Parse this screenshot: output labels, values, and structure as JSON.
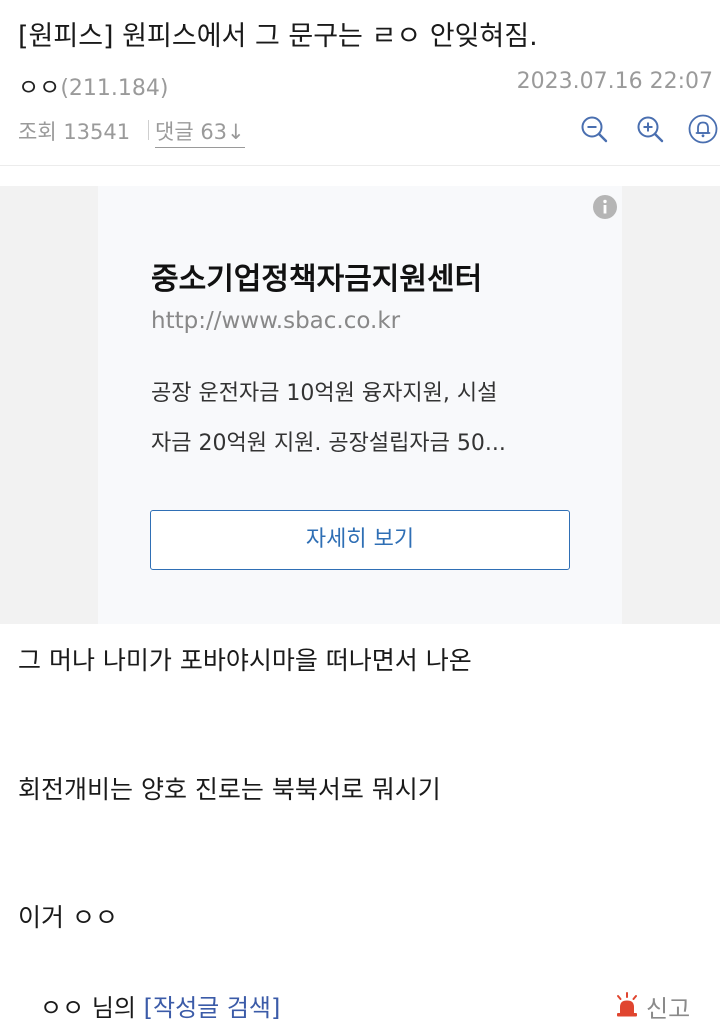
{
  "post": {
    "title": "[원피스] 원피스에서 그 문구는 ㄹㅇ 안잊혀짐.",
    "author": "ㅇㅇ",
    "ip": "(211.184)",
    "date": "2023.07.16 22:07",
    "views_label": "조회 13541",
    "comments_label": "댓글 63↓"
  },
  "toolbar": {
    "icons": [
      "zoom-out-icon",
      "zoom-in-icon",
      "bell-icon"
    ]
  },
  "ad": {
    "title": "중소기업정책자금지원센터",
    "url": "http://www.sbac.co.kr",
    "desc_lines": [
      "공장 운전자금 10억원 융자지원, 시설",
      "자금 20억원 지원. 공장설립자금 50..."
    ],
    "button_label": "자세히 보기",
    "info_icon": "info-icon"
  },
  "body": {
    "lines": [
      "그 머나 나미가 포바야시마을 떠나면서 나온",
      "회전개비는 양호 진로는 북북서로 뭐시기",
      "이거 ㅇㅇ"
    ]
  },
  "footer": {
    "author_name": "ㅇㅇ",
    "author_suffix": "님의",
    "search_link": "[작성글 검색]",
    "report_label": "신고",
    "report_color": "#e0452f"
  }
}
